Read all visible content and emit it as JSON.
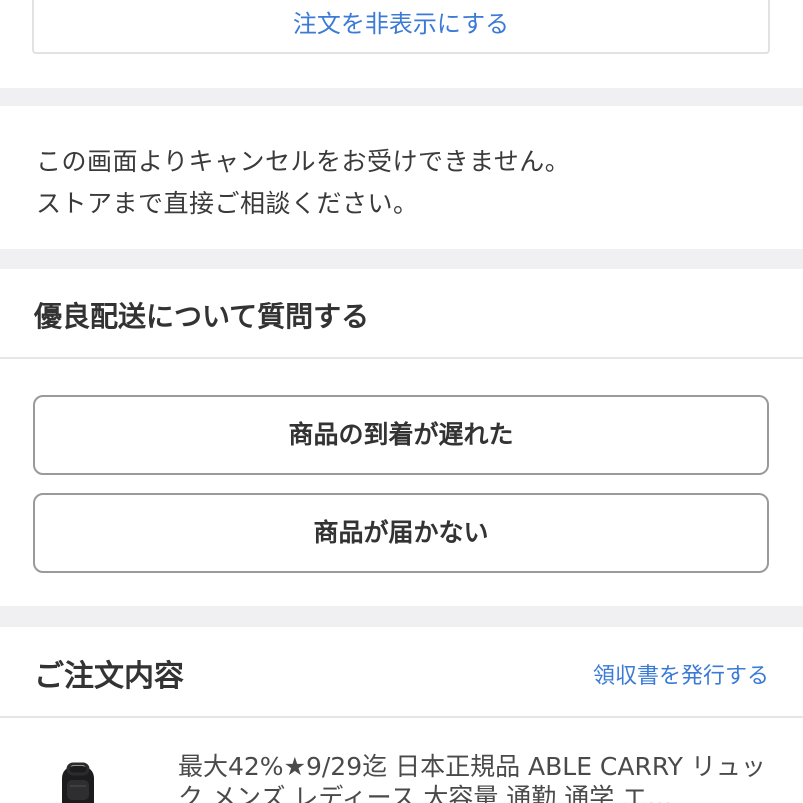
{
  "order_visibility": {
    "hide_label": "注文を非表示にする"
  },
  "cancel_notice": {
    "line1": "この画面よりキャンセルをお受けできません。",
    "line2": "ストアまで直接ご相談ください。"
  },
  "shipping_inquiry": {
    "title": "優良配送について質問する",
    "buttons": [
      {
        "label": "商品の到着が遅れた"
      },
      {
        "label": "商品が届かない"
      }
    ]
  },
  "order_details": {
    "title": "ご注文内容",
    "receipt_label": "領収書を発行する",
    "product": {
      "name": "最大42%★9/29迄 日本正規品 ABLE CARRY リュック メンズ レディース 大容量 通勤 通学 エ…",
      "thumbnail_icon": "backpack-icon"
    }
  },
  "colors": {
    "link": "#3b7bd6",
    "text": "#333333",
    "background": "#f0f0f2"
  }
}
